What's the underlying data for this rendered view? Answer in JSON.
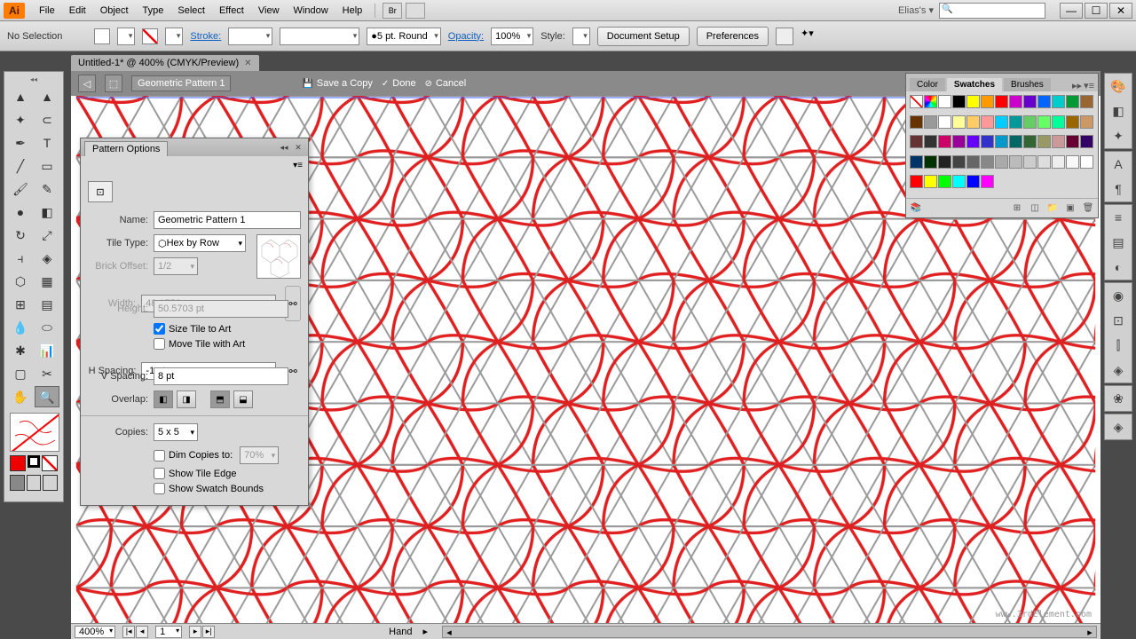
{
  "menu": {
    "items": [
      "File",
      "Edit",
      "Object",
      "Type",
      "Select",
      "Effect",
      "View",
      "Window",
      "Help"
    ],
    "user": "Elias's"
  },
  "control": {
    "selection": "No Selection",
    "stroke_label": "Stroke:",
    "stroke_profile": "5 pt. Round",
    "opacity_label": "Opacity:",
    "opacity_value": "100%",
    "style_label": "Style:",
    "doc_setup": "Document Setup",
    "prefs": "Preferences"
  },
  "doctab": "Untitled-1* @ 400% (CMYK/Preview)",
  "pattern_bar": {
    "name": "Geometric Pattern 1",
    "save": "Save a Copy",
    "done": "Done",
    "cancel": "Cancel"
  },
  "pattern_options": {
    "title": "Pattern Options",
    "name_label": "Name:",
    "name_value": "Geometric Pattern 1",
    "tile_label": "Tile Type:",
    "tile_value": "Hex by Row",
    "brick_label": "Brick Offset:",
    "brick_value": "1/2",
    "width_label": "Width:",
    "width_value": "48.1553 pt",
    "height_label": "Height:",
    "height_value": "50.5703 pt",
    "size_tile": "Size Tile to Art",
    "move_tile": "Move Tile with Art",
    "hspacing_label": "H Spacing:",
    "hspacing_value": "-1 pt",
    "vspacing_label": "V Spacing:",
    "8 pt": "8 pt",
    "overlap_label": "Overlap:",
    "copies_label": "Copies:",
    "copies_value": "5 x 5",
    "dim_label": "Dim Copies to:",
    "dim_value": "70%",
    "show_edge": "Show Tile Edge",
    "show_bounds": "Show Swatch Bounds"
  },
  "swatches": {
    "tabs": [
      "Color",
      "Swatches",
      "Brushes"
    ],
    "colors": [
      "#ffffff",
      "#000000",
      "#ffff00",
      "#ff9900",
      "#ff0000",
      "#cc00cc",
      "#6600cc",
      "#0066ff",
      "#00cccc",
      "#009933",
      "#996633",
      "#663300",
      "#999999",
      "#ffffff",
      "#ffff99",
      "#ffcc66",
      "#ff9999",
      "#00ccff",
      "#009999",
      "#66cc66",
      "#66ff66",
      "#00ff99",
      "#996600",
      "#cc9966",
      "#663333",
      "#333333",
      "#cc0066",
      "#990099",
      "#6600ff",
      "#3333cc",
      "#0099cc",
      "#006666",
      "#336633",
      "#999966",
      "#cc9999",
      "#660033",
      "#330066",
      "#003366",
      "#003300",
      "#222222",
      "#444444",
      "#666666",
      "#888888",
      "#aaaaaa",
      "#bbbbbb",
      "#cccccc",
      "#dddddd",
      "#eeeeee",
      "#f8f8f8",
      "#ffffff",
      "#ff0000",
      "#ffff00",
      "#00ff00",
      "#00ffff",
      "#0000ff",
      "#ff00ff"
    ]
  },
  "status": {
    "zoom": "400%",
    "page": "1",
    "tool": "Hand"
  },
  "watermark": "www.3rdElement.com"
}
